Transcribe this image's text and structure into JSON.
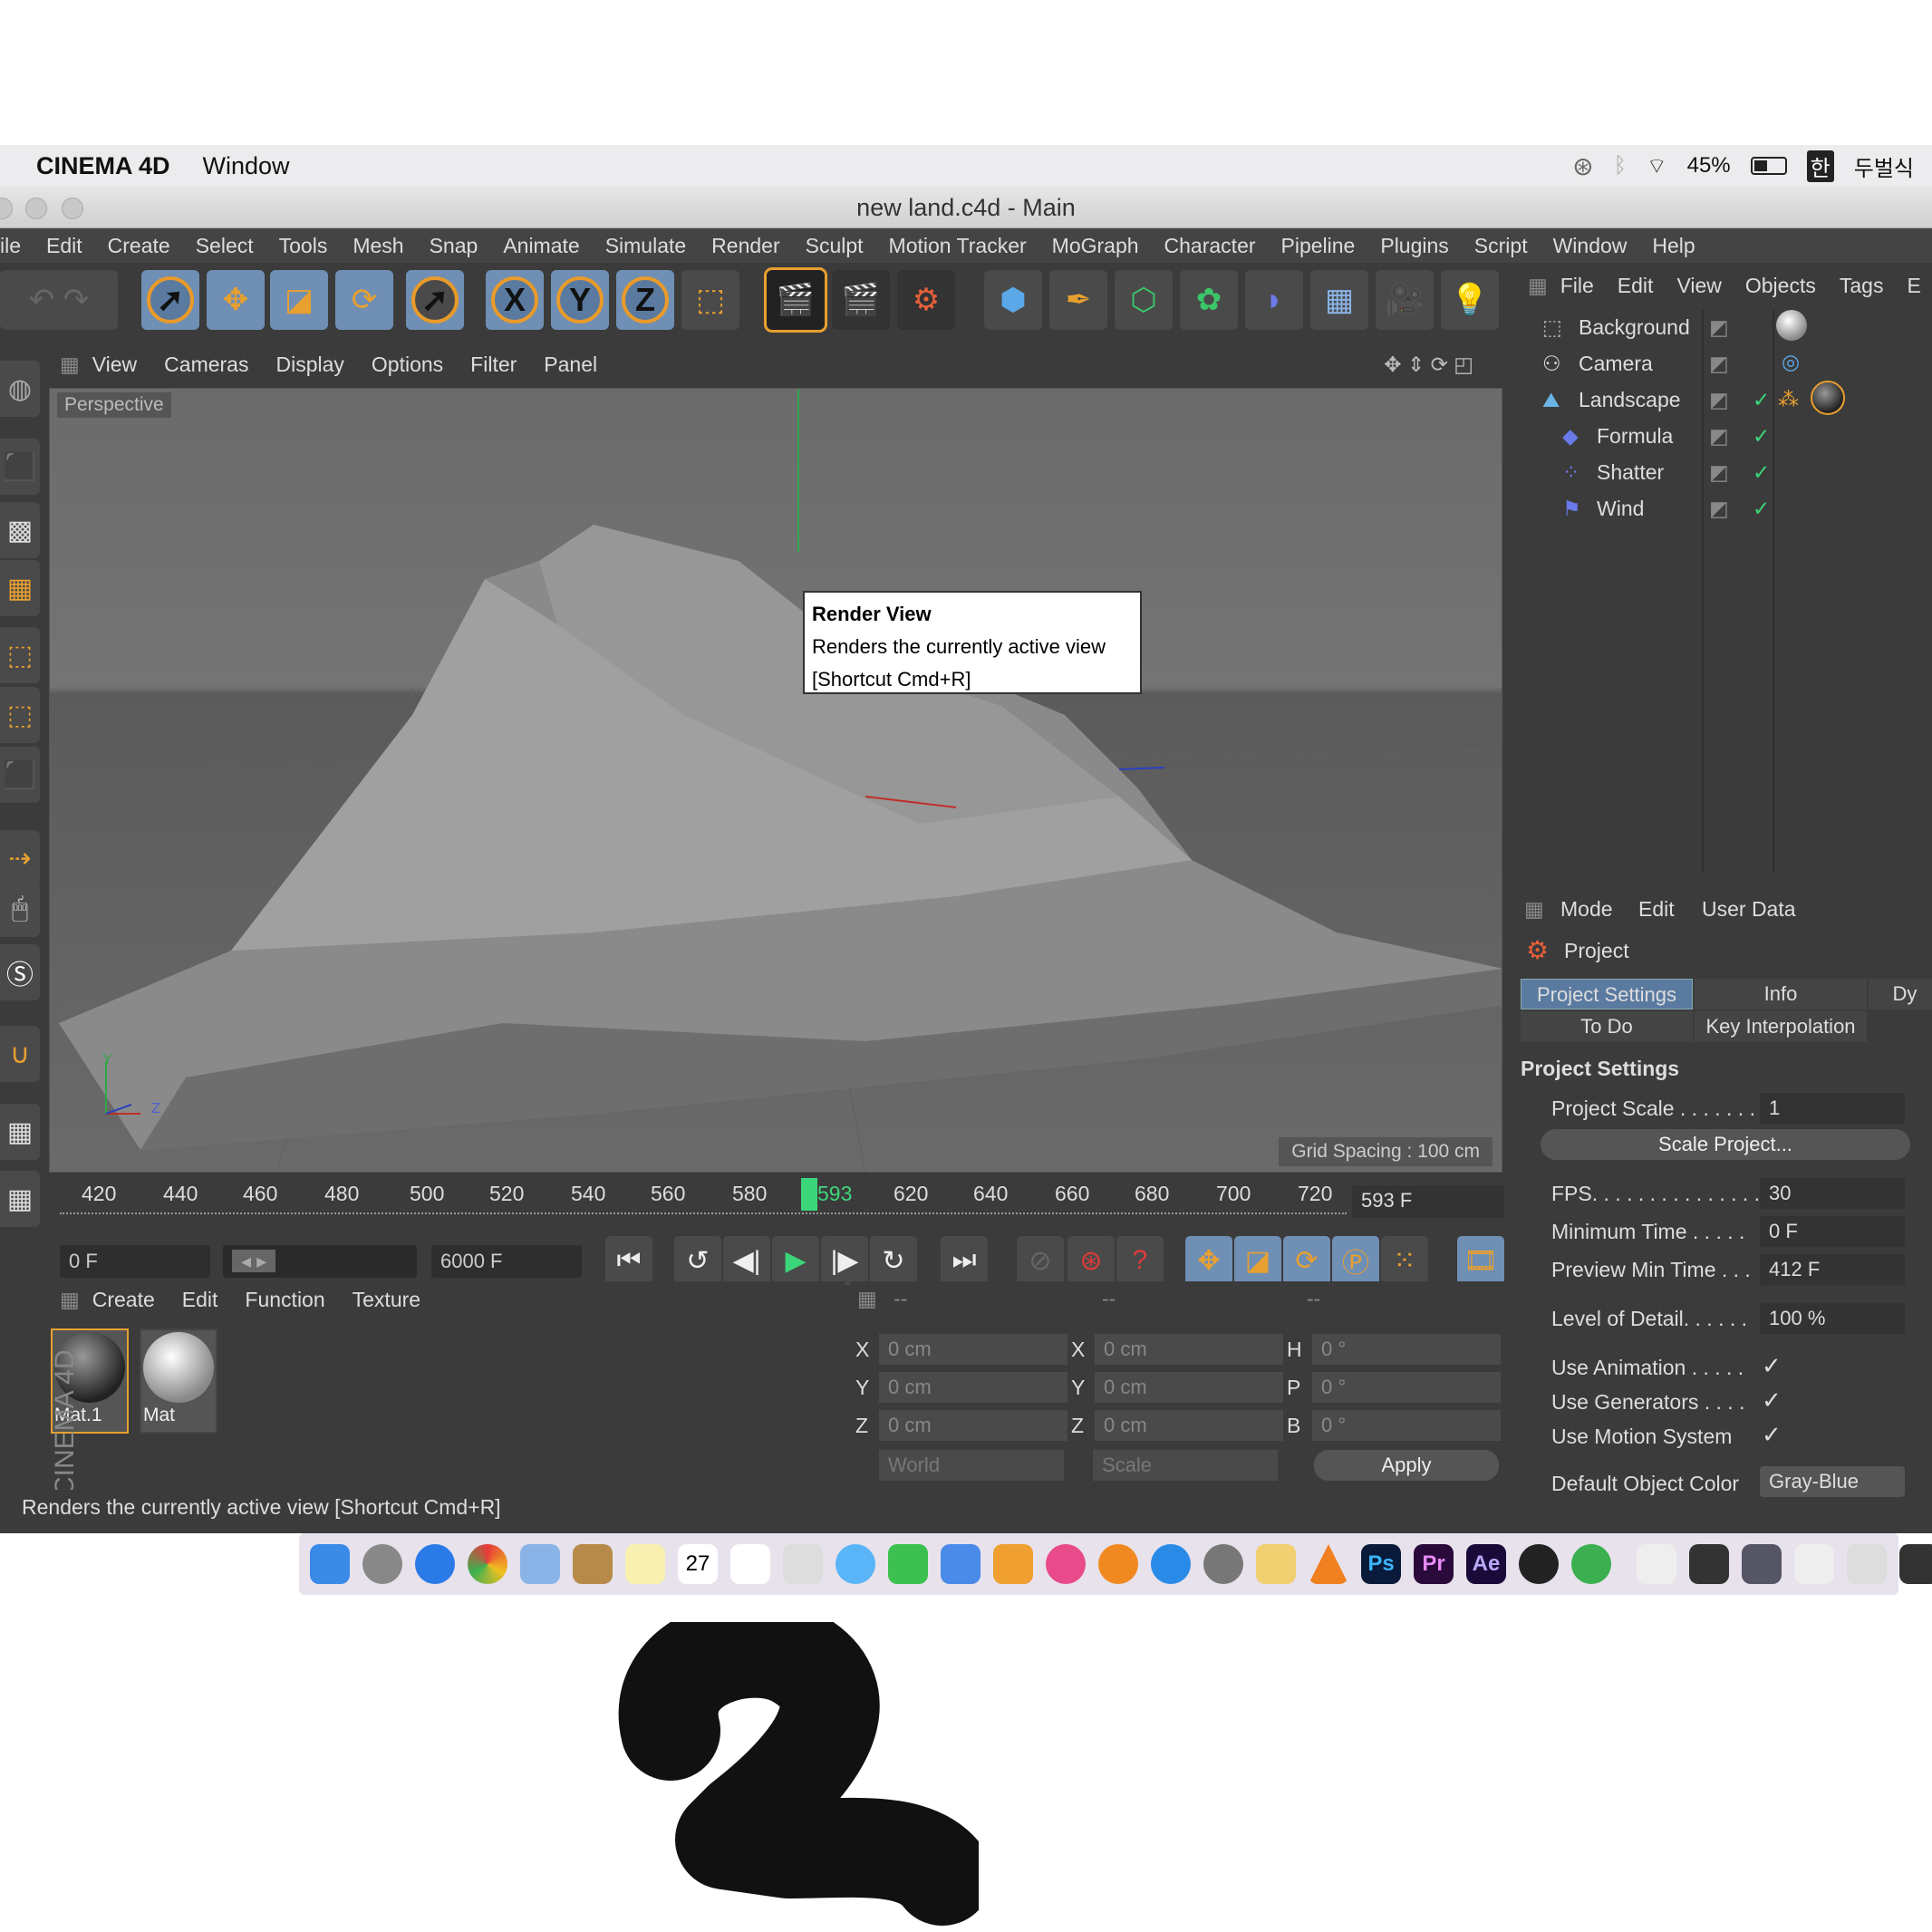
{
  "mac_menubar": {
    "app": "CINEMA 4D",
    "window": "Window",
    "battery": "45%",
    "input": "두벌식"
  },
  "titlebar": {
    "title": "new land.c4d - Main"
  },
  "main_menu": [
    "ile",
    "Edit",
    "Create",
    "Select",
    "Tools",
    "Mesh",
    "Snap",
    "Animate",
    "Simulate",
    "Render",
    "Sculpt",
    "Motion Tracker",
    "MoGraph",
    "Character",
    "Pipeline",
    "Plugins",
    "Script",
    "Window",
    "Help"
  ],
  "toolbar": {
    "x": "X",
    "y": "Y",
    "z": "Z"
  },
  "viewport": {
    "menu": [
      "View",
      "Cameras",
      "Display",
      "Options",
      "Filter",
      "Panel"
    ],
    "label": "Perspective",
    "grid_spacing": "Grid Spacing : 100 cm",
    "axis_y": "Y",
    "axis_z": "Z"
  },
  "tooltip": {
    "title": "Render View",
    "desc": "Renders the currently active view",
    "shortcut": "[Shortcut Cmd+R]"
  },
  "timeline": {
    "ticks": [
      "420",
      "440",
      "460",
      "480",
      "500",
      "520",
      "540",
      "560",
      "580",
      "593",
      "620",
      "640",
      "660",
      "680",
      "700",
      "720"
    ],
    "current": "593 F",
    "start": "0 F",
    "end": "6000 F"
  },
  "materials": {
    "menu": [
      "Create",
      "Edit",
      "Function",
      "Texture"
    ],
    "items": [
      {
        "name": "Mat.1"
      },
      {
        "name": "Mat"
      }
    ],
    "brand": "CINEMA 4D"
  },
  "coords": {
    "headers": [
      "--",
      "--",
      "--"
    ],
    "rows": [
      {
        "a": "X",
        "av": "0 cm",
        "b": "X",
        "bv": "0 cm",
        "c": "H",
        "cv": "0 °"
      },
      {
        "a": "Y",
        "av": "0 cm",
        "b": "Y",
        "bv": "0 cm",
        "c": "P",
        "cv": "0 °"
      },
      {
        "a": "Z",
        "av": "0 cm",
        "b": "Z",
        "bv": "0 cm",
        "c": "B",
        "cv": "0 °"
      }
    ],
    "world": "World",
    "scale": "Scale",
    "apply": "Apply"
  },
  "status": "Renders the currently active view [Shortcut Cmd+R]",
  "objects": {
    "menu": [
      "File",
      "Edit",
      "View",
      "Objects",
      "Tags",
      "E"
    ],
    "items": [
      "Background",
      "Camera",
      "Landscape",
      "Formula",
      "Shatter",
      "Wind"
    ]
  },
  "attributes": {
    "menu": [
      "Mode",
      "Edit",
      "User Data"
    ],
    "project": "Project",
    "tabs": [
      "Project Settings",
      "Info",
      "Dy",
      "To Do",
      "Key Interpolation"
    ],
    "section": "Project Settings",
    "project_scale_label": "Project Scale . . . . . . .",
    "project_scale": "1",
    "scale_project": "Scale Project...",
    "fps_label": "FPS. . . . . . . . . . . . . . .",
    "fps": "30",
    "min_time_label": "Minimum Time . . . . .",
    "min_time": "0 F",
    "preview_min_label": "Preview Min Time . . .",
    "preview_min": "412 F",
    "lod_label": "Level of Detail. . . . . .",
    "lod": "100 %",
    "use_animation": "Use Animation . . . . .",
    "use_generators": "Use Generators . . . .",
    "use_motion": "Use Motion System",
    "default_color_label": "Default Object Color",
    "default_color": "Gray-Blue"
  },
  "dock": {
    "app_ps": "Ps",
    "app_pr": "Pr",
    "app_ae": "Ae",
    "cal_day": "27"
  },
  "handwritten": "2"
}
